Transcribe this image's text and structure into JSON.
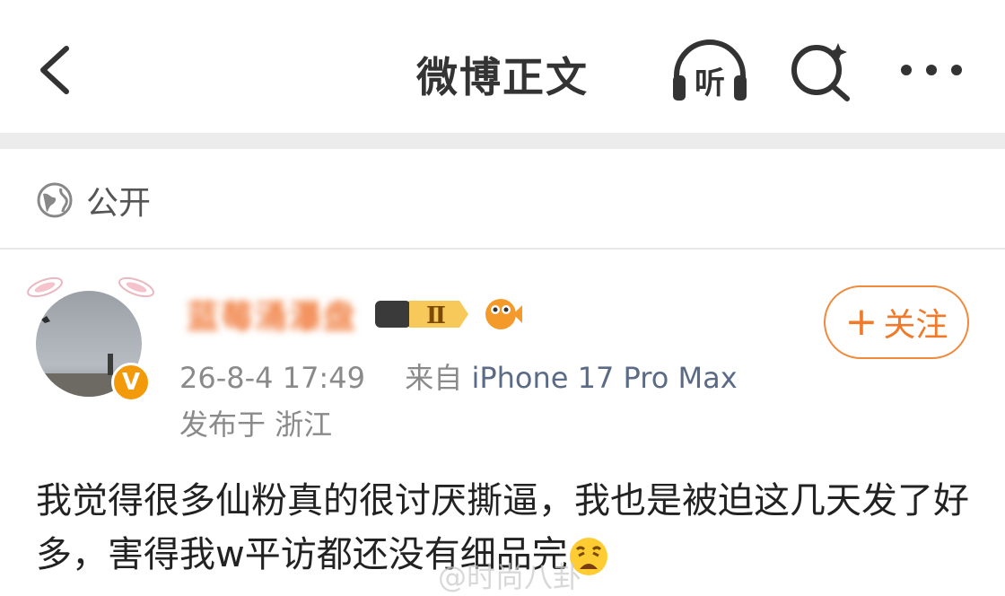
{
  "header": {
    "title": "微博正文",
    "listen_label": "听"
  },
  "visibility": {
    "label": "公开"
  },
  "post": {
    "author": {
      "name": "蓝莓涌瀑盘",
      "level": "Ⅱ",
      "verified_badge": "V"
    },
    "follow_label": "关注",
    "follow_plus": "+",
    "time": "26-8-4 17:49",
    "source_prefix": "来自",
    "source": "iPhone 17 Pro Max",
    "location": "发布于 浙江",
    "content": "我觉得很多仙粉真的很讨厌撕逼，我也是被迫这几天发了好多，害得我w平访都还没有细品完",
    "watermark": "@时尚八卦"
  },
  "icons": {
    "back": "chevron-left-icon",
    "listen": "headphones-icon",
    "search": "search-icon",
    "more": "more-icon",
    "globe": "globe-icon"
  },
  "colors": {
    "accent": "#f07a2a",
    "link": "#5b6b86",
    "divider": "#ececec"
  }
}
